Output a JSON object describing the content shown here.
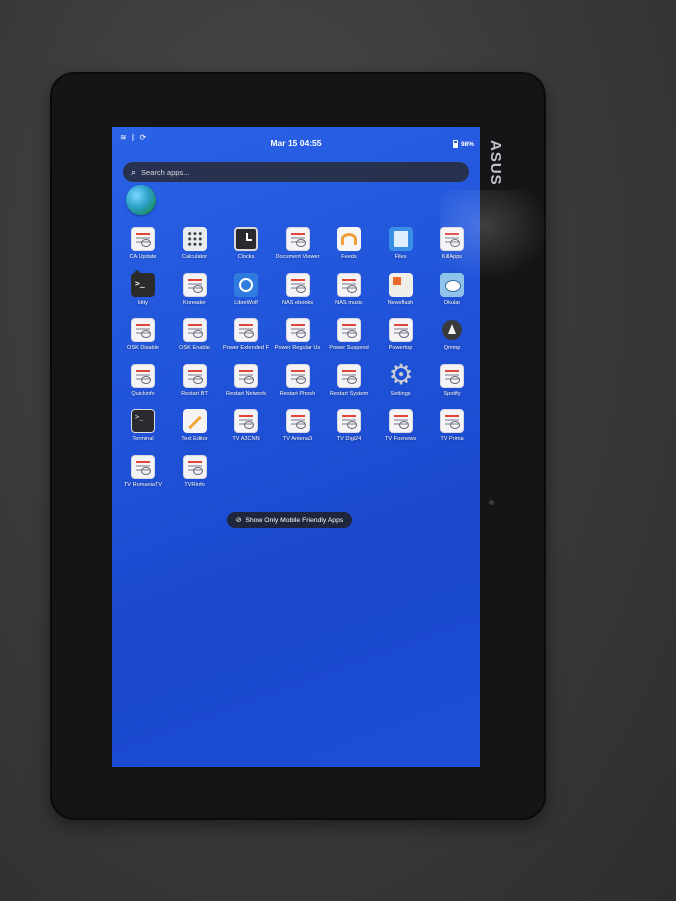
{
  "device": {
    "brand": "ASUS"
  },
  "status_bar": {
    "icons": [
      "wifi-icon",
      "bluetooth-icon",
      "screen-rotate-icon"
    ],
    "clock": "Mar 15  04:55",
    "battery": "98%"
  },
  "search": {
    "placeholder": "Search apps..."
  },
  "apps": [
    {
      "label": "CA Update",
      "icon": "doc"
    },
    {
      "label": "Calculator",
      "icon": "calc"
    },
    {
      "label": "Clocks",
      "icon": "clockicon"
    },
    {
      "label": "Document Viewer",
      "icon": "doc"
    },
    {
      "label": "Feeds",
      "icon": "feeds"
    },
    {
      "label": "Files",
      "icon": "files"
    },
    {
      "label": "KillApps",
      "icon": "doc"
    },
    {
      "label": "kitty",
      "icon": "kitty"
    },
    {
      "label": "Koreader",
      "icon": "doc"
    },
    {
      "label": "LibreWolf",
      "icon": "libre"
    },
    {
      "label": "NAS ebooks",
      "icon": "doc"
    },
    {
      "label": "NAS music",
      "icon": "doc"
    },
    {
      "label": "Newsflash",
      "icon": "newsflash"
    },
    {
      "label": "Okular",
      "icon": "okular"
    },
    {
      "label": "OSK Disable",
      "icon": "doc"
    },
    {
      "label": "OSK Enable",
      "icon": "doc"
    },
    {
      "label": "Power Extended F",
      "icon": "doc"
    },
    {
      "label": "Power Regular Us",
      "icon": "doc"
    },
    {
      "label": "Power Suspend",
      "icon": "doc"
    },
    {
      "label": "Powertop",
      "icon": "doc"
    },
    {
      "label": "Qmmp",
      "icon": "qmmp"
    },
    {
      "label": "Quickinfo",
      "icon": "doc"
    },
    {
      "label": "Restart BT",
      "icon": "doc"
    },
    {
      "label": "Restart Network",
      "icon": "doc"
    },
    {
      "label": "Restart Phosh",
      "icon": "doc"
    },
    {
      "label": "Restart System",
      "icon": "doc"
    },
    {
      "label": "Settings",
      "icon": "settings"
    },
    {
      "label": "Spotify",
      "icon": "doc"
    },
    {
      "label": "Terminal",
      "icon": "terminal"
    },
    {
      "label": "Text Editor",
      "icon": "texteditor"
    },
    {
      "label": "TV A3CNN",
      "icon": "doc"
    },
    {
      "label": "TV Antena3",
      "icon": "doc"
    },
    {
      "label": "TV Digi24",
      "icon": "doc"
    },
    {
      "label": "TV Foxnews",
      "icon": "doc"
    },
    {
      "label": "TV Prima",
      "icon": "doc"
    },
    {
      "label": "TV RomaniaTV",
      "icon": "doc"
    },
    {
      "label": "TVRInfo",
      "icon": "doc"
    }
  ],
  "filter_button": {
    "label": "Show Only Mobile Friendly Apps",
    "icon": "eye-slash-icon"
  }
}
